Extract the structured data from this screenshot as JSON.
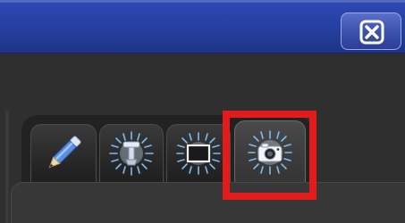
{
  "window": {
    "close_icon": "close-icon"
  },
  "tabs": [
    {
      "id": "pen",
      "icon": "pencil-icon",
      "active": false
    },
    {
      "id": "tool",
      "icon": "stamp-tool-icon",
      "active": false
    },
    {
      "id": "frame",
      "icon": "frame-icon",
      "active": false
    },
    {
      "id": "camera",
      "icon": "camera-icon",
      "active": true
    }
  ],
  "colors": {
    "titlebar": "#253f9f",
    "highlight": "#e41b1b",
    "glow": "#7fc3ff"
  }
}
